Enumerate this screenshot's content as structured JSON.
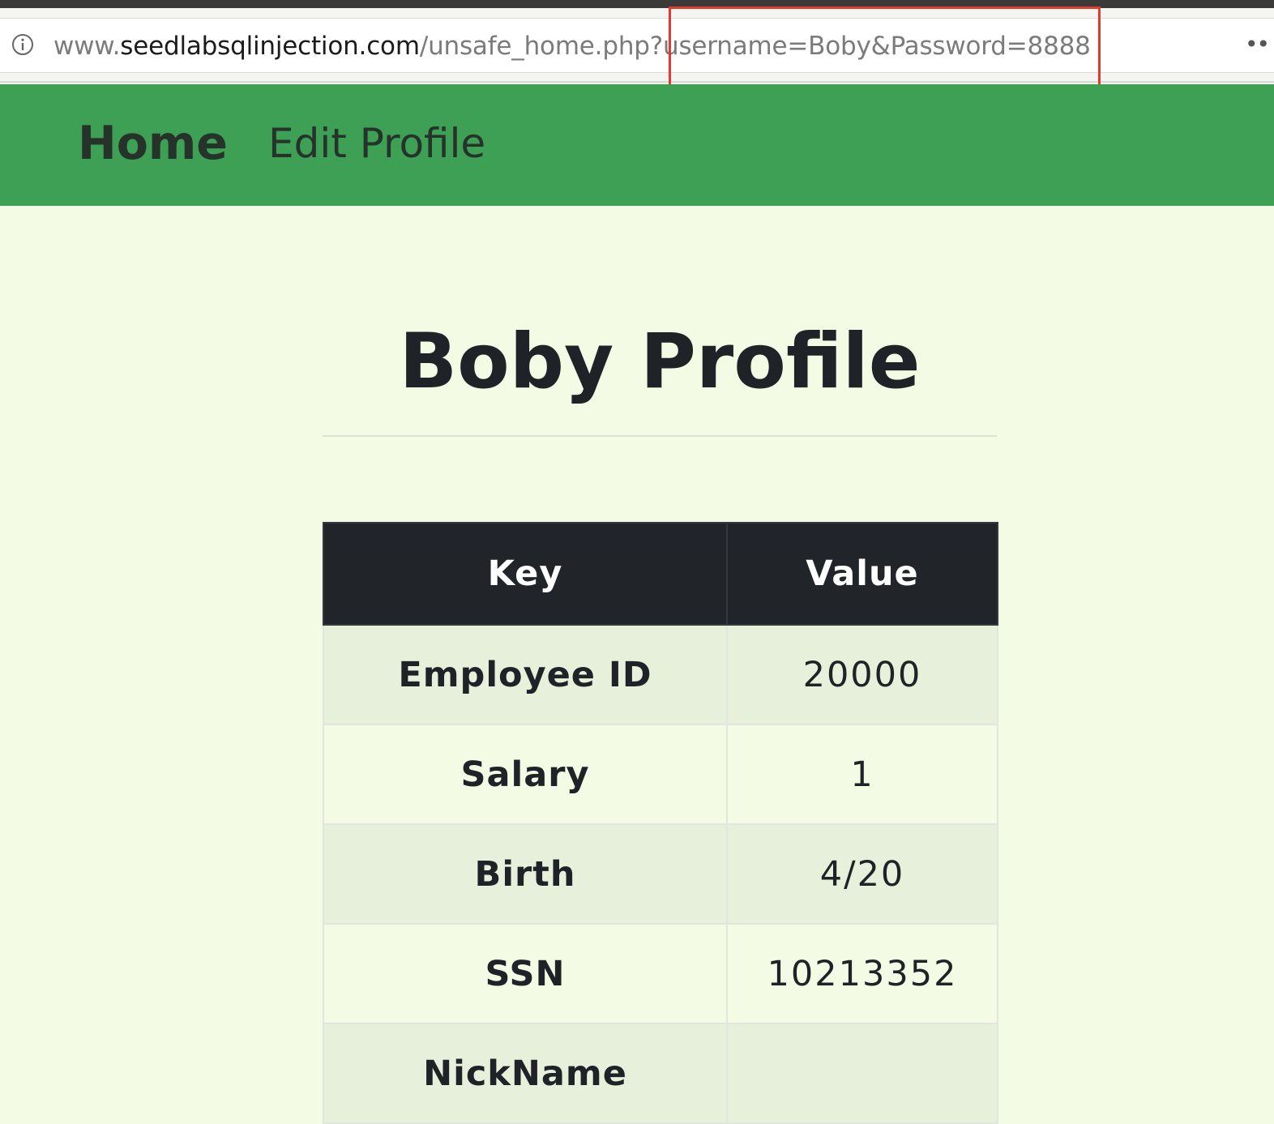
{
  "browser": {
    "url": {
      "prefix": "www.",
      "domain": "seedlabsqlinjection.com",
      "path": "/unsafe_home.php?username=Boby&Password=8888"
    },
    "info_icon": "info-icon",
    "menu_icon": "more-dots-icon",
    "highlight_color": "#e23b2e"
  },
  "navbar": {
    "home_label": "Home",
    "edit_profile_label": "Edit Profile",
    "background_color": "#3ea055"
  },
  "profile": {
    "title": "Boby Profile",
    "table": {
      "headers": {
        "key": "Key",
        "value": "Value"
      },
      "rows": [
        {
          "key": "Employee ID",
          "value": "20000"
        },
        {
          "key": "Salary",
          "value": "1"
        },
        {
          "key": "Birth",
          "value": "4/20"
        },
        {
          "key": "SSN",
          "value": "10213352"
        },
        {
          "key": "NickName",
          "value": ""
        }
      ]
    }
  }
}
